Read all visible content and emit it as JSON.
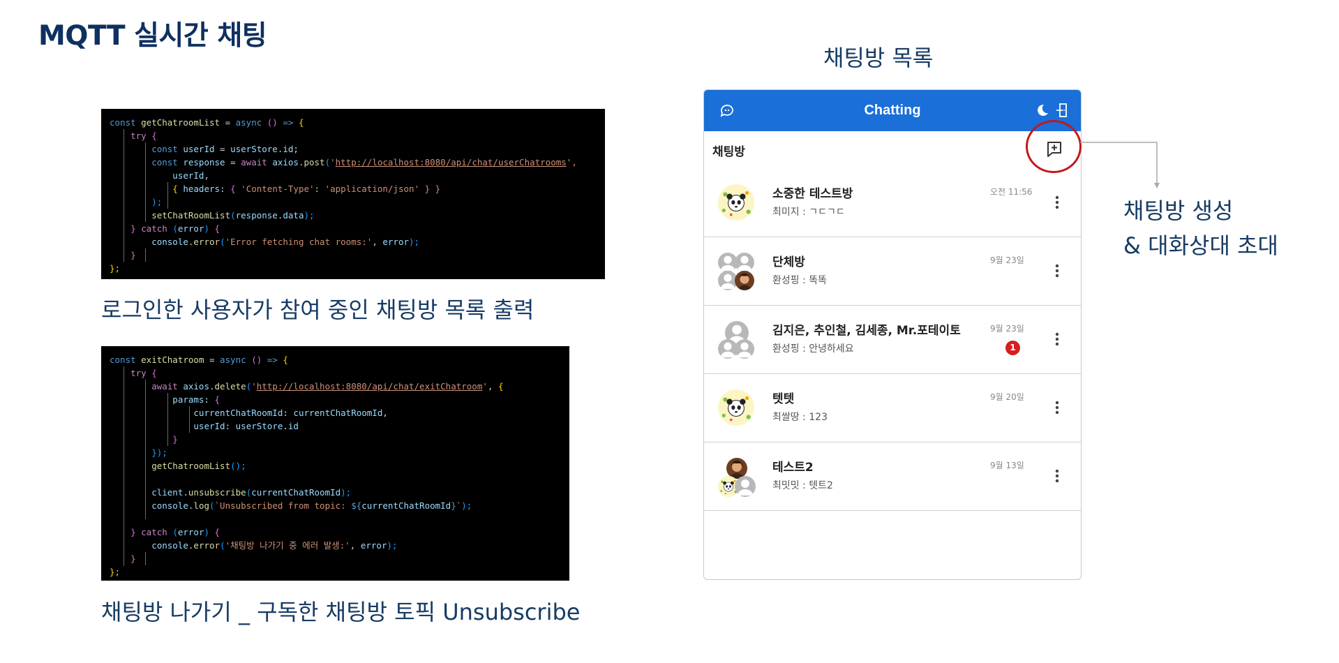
{
  "slide": {
    "title": "MQTT 실시간 채팅",
    "caption1": "로그인한 사용자가 참여 중인 채팅방 목록 출력",
    "caption2": "채팅방 나가기 _ 구독한 채팅방 토픽 Unsubscribe",
    "section_label": "채팅방 목록",
    "annotation_line1": "채팅방 생성",
    "annotation_line2": "& 대화상대 초대"
  },
  "code1": {
    "lines": [
      [
        {
          "t": "const ",
          "c": "kw"
        },
        {
          "t": "getChatroomList",
          "c": "fn"
        },
        {
          "t": " = ",
          "c": "punc"
        },
        {
          "t": "async",
          "c": "kw"
        },
        {
          "t": " () ",
          "c": "br2"
        },
        {
          "t": "=> ",
          "c": "kw"
        },
        {
          "t": "{",
          "c": "br1"
        }
      ],
      [
        {
          "t": "    try ",
          "c": "ctl"
        },
        {
          "t": "{",
          "c": "br2"
        }
      ],
      [
        {
          "t": "        const ",
          "c": "kw"
        },
        {
          "t": "userId",
          "c": "var"
        },
        {
          "t": " = ",
          "c": "punc"
        },
        {
          "t": "userStore",
          "c": "var"
        },
        {
          "t": ".",
          "c": "punc"
        },
        {
          "t": "id",
          "c": "var"
        },
        {
          "t": ";",
          "c": "punc"
        }
      ],
      [
        {
          "t": "        const ",
          "c": "kw"
        },
        {
          "t": "response",
          "c": "var"
        },
        {
          "t": " = ",
          "c": "punc"
        },
        {
          "t": "await ",
          "c": "ctl"
        },
        {
          "t": "axios",
          "c": "var"
        },
        {
          "t": ".",
          "c": "punc"
        },
        {
          "t": "post",
          "c": "fn"
        },
        {
          "t": "(",
          "c": "br3"
        },
        {
          "t": "'",
          "c": "str"
        },
        {
          "t": "http://localhost:8080/api/chat/userChatrooms",
          "c": "url"
        },
        {
          "t": "',",
          "c": "str"
        }
      ],
      [
        {
          "t": "            userId",
          "c": "var"
        },
        {
          "t": ",",
          "c": "punc"
        }
      ],
      [
        {
          "t": "            { ",
          "c": "br1"
        },
        {
          "t": "headers",
          "c": "var"
        },
        {
          "t": ": ",
          "c": "punc"
        },
        {
          "t": "{ ",
          "c": "br2"
        },
        {
          "t": "'Content-Type'",
          "c": "str"
        },
        {
          "t": ": ",
          "c": "punc"
        },
        {
          "t": "'application/json'",
          "c": "str"
        },
        {
          "t": " } }",
          "c": "br2"
        }
      ],
      [
        {
          "t": "        );",
          "c": "br3"
        }
      ],
      [
        {
          "t": "        setChatRoomList",
          "c": "fn"
        },
        {
          "t": "(",
          "c": "br3"
        },
        {
          "t": "response",
          "c": "var"
        },
        {
          "t": ".",
          "c": "punc"
        },
        {
          "t": "data",
          "c": "var"
        },
        {
          "t": ");",
          "c": "br3"
        }
      ],
      [
        {
          "t": "    } ",
          "c": "br2"
        },
        {
          "t": "catch ",
          "c": "ctl"
        },
        {
          "t": "(",
          "c": "br3"
        },
        {
          "t": "error",
          "c": "var"
        },
        {
          "t": ") ",
          "c": "br3"
        },
        {
          "t": "{",
          "c": "br2"
        }
      ],
      [
        {
          "t": "        console",
          "c": "var"
        },
        {
          "t": ".",
          "c": "punc"
        },
        {
          "t": "error",
          "c": "fn"
        },
        {
          "t": "(",
          "c": "br3"
        },
        {
          "t": "'Error fetching chat rooms:'",
          "c": "str"
        },
        {
          "t": ", ",
          "c": "punc"
        },
        {
          "t": "error",
          "c": "var"
        },
        {
          "t": ");",
          "c": "br3"
        }
      ],
      [
        {
          "t": "    }",
          "c": "br2"
        }
      ],
      [
        {
          "t": "};",
          "c": "br1"
        }
      ]
    ]
  },
  "code2": {
    "lines": [
      [
        {
          "t": "const ",
          "c": "kw"
        },
        {
          "t": "exitChatroom",
          "c": "fn"
        },
        {
          "t": " = ",
          "c": "punc"
        },
        {
          "t": "async",
          "c": "kw"
        },
        {
          "t": " () ",
          "c": "br2"
        },
        {
          "t": "=> ",
          "c": "kw"
        },
        {
          "t": "{",
          "c": "br1"
        }
      ],
      [
        {
          "t": "    try ",
          "c": "ctl"
        },
        {
          "t": "{",
          "c": "br2"
        }
      ],
      [
        {
          "t": "        await ",
          "c": "ctl"
        },
        {
          "t": "axios",
          "c": "var"
        },
        {
          "t": ".",
          "c": "punc"
        },
        {
          "t": "delete",
          "c": "fn"
        },
        {
          "t": "(",
          "c": "br3"
        },
        {
          "t": "'",
          "c": "str"
        },
        {
          "t": "http://localhost:8080/api/chat/exitChatroom",
          "c": "url"
        },
        {
          "t": "'",
          "c": "str"
        },
        {
          "t": ", ",
          "c": "punc"
        },
        {
          "t": "{",
          "c": "br1"
        }
      ],
      [
        {
          "t": "            params",
          "c": "var"
        },
        {
          "t": ": ",
          "c": "punc"
        },
        {
          "t": "{",
          "c": "br2"
        }
      ],
      [
        {
          "t": "                currentChatRoomId",
          "c": "var"
        },
        {
          "t": ": ",
          "c": "punc"
        },
        {
          "t": "currentChatRoomId",
          "c": "var"
        },
        {
          "t": ",",
          "c": "punc"
        }
      ],
      [
        {
          "t": "                userId",
          "c": "var"
        },
        {
          "t": ": ",
          "c": "punc"
        },
        {
          "t": "userStore",
          "c": "var"
        },
        {
          "t": ".",
          "c": "punc"
        },
        {
          "t": "id",
          "c": "var"
        }
      ],
      [
        {
          "t": "            }",
          "c": "br2"
        }
      ],
      [
        {
          "t": "        });",
          "c": "br3"
        }
      ],
      [
        {
          "t": "        getChatroomList",
          "c": "fn"
        },
        {
          "t": "();",
          "c": "br3"
        }
      ],
      [
        {
          "t": "",
          "c": "punc"
        }
      ],
      [
        {
          "t": "        client",
          "c": "var"
        },
        {
          "t": ".",
          "c": "punc"
        },
        {
          "t": "unsubscribe",
          "c": "fn"
        },
        {
          "t": "(",
          "c": "br3"
        },
        {
          "t": "currentChatRoomId",
          "c": "var"
        },
        {
          "t": ");",
          "c": "br3"
        }
      ],
      [
        {
          "t": "        console",
          "c": "var"
        },
        {
          "t": ".",
          "c": "punc"
        },
        {
          "t": "log",
          "c": "fn"
        },
        {
          "t": "(",
          "c": "br3"
        },
        {
          "t": "`Unsubscribed from topic: ",
          "c": "str"
        },
        {
          "t": "${",
          "c": "kw"
        },
        {
          "t": "currentChatRoomId",
          "c": "var"
        },
        {
          "t": "}",
          "c": "kw"
        },
        {
          "t": "`",
          "c": "str"
        },
        {
          "t": ");",
          "c": "br3"
        }
      ],
      [
        {
          "t": "",
          "c": "punc"
        }
      ],
      [
        {
          "t": "    } ",
          "c": "br2"
        },
        {
          "t": "catch ",
          "c": "ctl"
        },
        {
          "t": "(",
          "c": "br3"
        },
        {
          "t": "error",
          "c": "var"
        },
        {
          "t": ") ",
          "c": "br3"
        },
        {
          "t": "{",
          "c": "br2"
        }
      ],
      [
        {
          "t": "        console",
          "c": "var"
        },
        {
          "t": ".",
          "c": "punc"
        },
        {
          "t": "error",
          "c": "fn"
        },
        {
          "t": "(",
          "c": "br3"
        },
        {
          "t": "'채팅방 나가기 중 에러 발생:'",
          "c": "str"
        },
        {
          "t": ", ",
          "c": "punc"
        },
        {
          "t": "error",
          "c": "var"
        },
        {
          "t": ");",
          "c": "br3"
        }
      ],
      [
        {
          "t": "    }",
          "c": "br2"
        }
      ],
      [
        {
          "t": "};",
          "c": "br1"
        }
      ]
    ]
  },
  "app": {
    "header_title": "Chatting",
    "subheader_label": "채팅방",
    "icons": {
      "header_left": "chat-bubble-icon",
      "header_right_1": "moon-icon",
      "header_right_2": "exit-door-icon",
      "new_chat": "add-chat-icon",
      "room_menu": "more-vertical-icon"
    },
    "colors": {
      "header_bg": "#1a6fd8",
      "unread_badge": "#d42020",
      "highlight": "#c4171b"
    },
    "rooms": [
      {
        "name": "소중한 테스트방",
        "last_message": "최미지 : ㄱㄷㄱㄷ",
        "time": "오전 11:56",
        "unread": "",
        "avatar": "panda"
      },
      {
        "name": "단체방",
        "last_message": "환성핑 : 똑똑",
        "time": "9월 23일",
        "unread": "",
        "avatar": "group-gray-photo"
      },
      {
        "name": "김지은, 추인철, 김세종, Mr.포테이토",
        "last_message": "환성핑 : 안녕하세요",
        "time": "9월 23일",
        "unread": "1",
        "avatar": "group-gray"
      },
      {
        "name": "텟텟",
        "last_message": "최쌀땅 : 123",
        "time": "9월 20일",
        "unread": "",
        "avatar": "panda"
      },
      {
        "name": "테스트2",
        "last_message": "최밋밋 : 텟트2",
        "time": "9월 13일",
        "unread": "",
        "avatar": "photo-panda-gray"
      }
    ]
  }
}
